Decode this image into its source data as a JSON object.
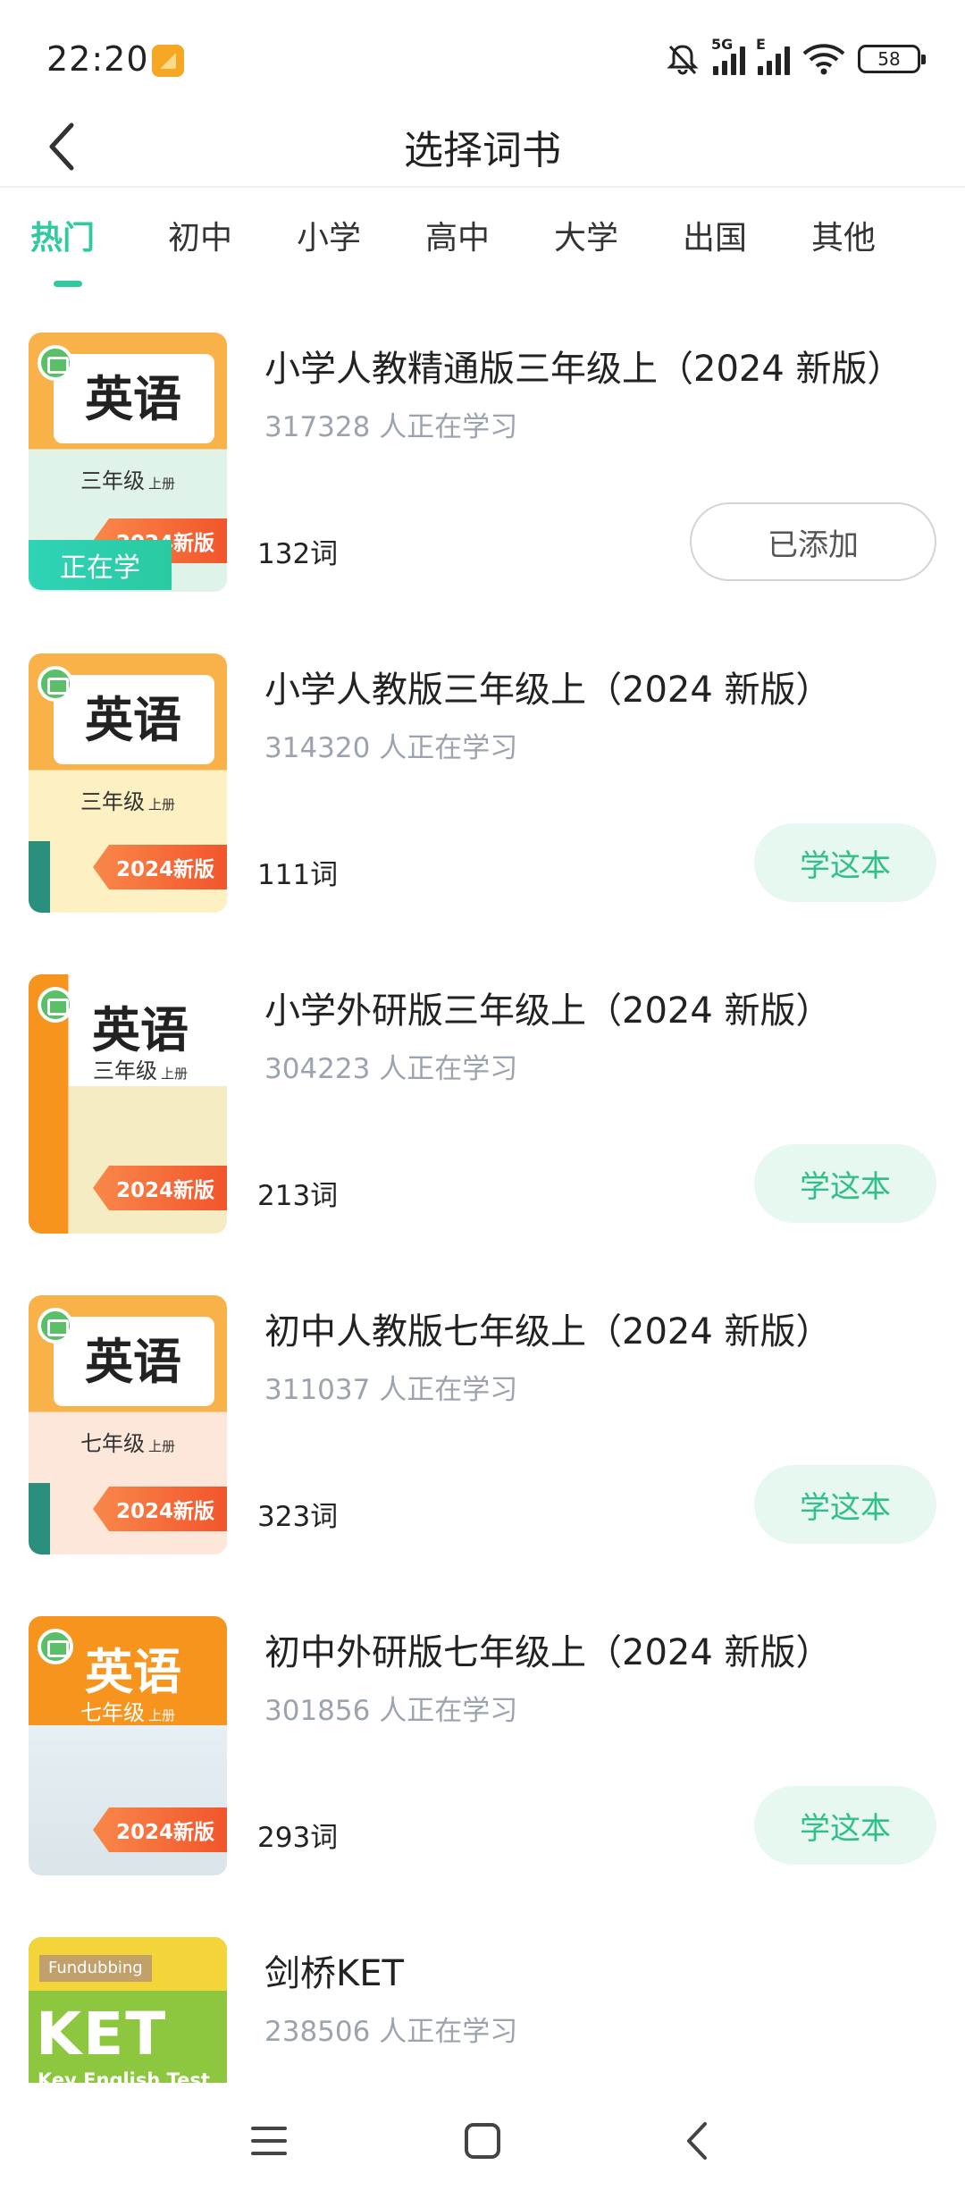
{
  "status_bar": {
    "time": "22:20",
    "network_tag_1": "5G",
    "network_tag_2": "E",
    "battery": "58",
    "icons": [
      "app-notification-icon",
      "mute-bell-icon",
      "signal-icon",
      "wifi-icon",
      "battery-icon"
    ]
  },
  "header": {
    "title": "选择词书",
    "back_icon": "chevron-left-icon"
  },
  "tabs": [
    {
      "label": "热门",
      "active": true
    },
    {
      "label": "初中",
      "active": false
    },
    {
      "label": "小学",
      "active": false
    },
    {
      "label": "高中",
      "active": false
    },
    {
      "label": "大学",
      "active": false
    },
    {
      "label": "出国",
      "active": false
    },
    {
      "label": "其他",
      "active": false
    }
  ],
  "books": [
    {
      "title": "小学人教精通版三年级上（2024 新版）",
      "learners": "317328 人正在学习",
      "words": "132词",
      "button": "已添加",
      "button_state": "added",
      "badge": "正在学",
      "cover": {
        "subject": "英语",
        "grade": "三年级",
        "volume": "上册",
        "edition": "2024新版",
        "colors": [
          "#f9b24a",
          "#dff3e8"
        ]
      }
    },
    {
      "title": "小学人教版三年级上（2024 新版）",
      "learners": "314320 人正在学习",
      "words": "111词",
      "button": "学这本",
      "button_state": "learn",
      "cover": {
        "subject": "英语",
        "grade": "三年级",
        "volume": "上册",
        "edition": "2024新版",
        "colors": [
          "#f9b24a",
          "#fdf1c4"
        ]
      }
    },
    {
      "title": "小学外研版三年级上（2024 新版）",
      "learners": "304223 人正在学习",
      "words": "213词",
      "button": "学这本",
      "button_state": "learn",
      "cover": {
        "subject": "英语",
        "grade": "三年级",
        "volume": "上册",
        "edition": "2024新版",
        "colors": [
          "#f7941d",
          "#f5ecc4"
        ]
      }
    },
    {
      "title": "初中人教版七年级上（2024 新版）",
      "learners": "311037 人正在学习",
      "words": "323词",
      "button": "学这本",
      "button_state": "learn",
      "cover": {
        "subject": "英语",
        "grade": "七年级",
        "volume": "上册",
        "edition": "2024新版",
        "colors": [
          "#f9b24a",
          "#fde7da"
        ]
      }
    },
    {
      "title": "初中外研版七年级上（2024 新版）",
      "learners": "301856 人正在学习",
      "words": "293词",
      "button": "学这本",
      "button_state": "learn",
      "cover": {
        "subject": "英语",
        "grade": "七年级",
        "volume": "上册",
        "edition": "2024新版",
        "colors": [
          "#f7941d",
          "#e6eff3"
        ]
      }
    },
    {
      "title": "剑桥KET",
      "learners": "238506 人正在学习",
      "cover": {
        "brand": "Fundubbing",
        "big": "KET",
        "sub": "Key English Test",
        "colors": [
          "#8dc63f",
          "#f3d53a"
        ]
      }
    }
  ],
  "nav_bar": {
    "icons": [
      "menu-icon",
      "home-square-icon",
      "back-triangle-icon"
    ]
  }
}
